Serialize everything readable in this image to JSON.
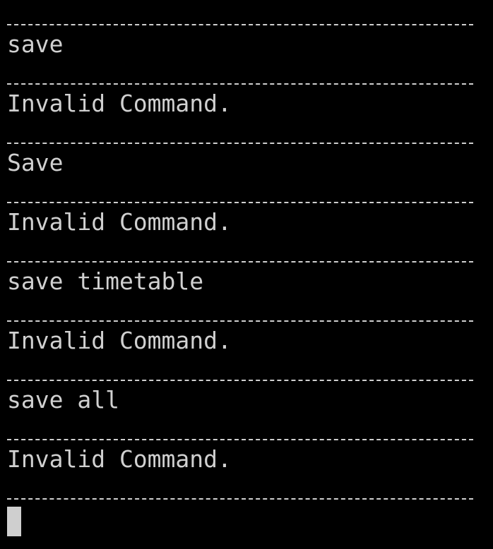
{
  "terminal": {
    "lines": [
      {
        "type": "separator"
      },
      {
        "type": "text",
        "text": "save"
      },
      {
        "type": "separator"
      },
      {
        "type": "text",
        "text": "Invalid Command."
      },
      {
        "type": "separator"
      },
      {
        "type": "text",
        "text": "Save"
      },
      {
        "type": "separator"
      },
      {
        "type": "text",
        "text": "Invalid Command."
      },
      {
        "type": "separator"
      },
      {
        "type": "text",
        "text": "save timetable"
      },
      {
        "type": "separator"
      },
      {
        "type": "text",
        "text": "Invalid Command."
      },
      {
        "type": "separator"
      },
      {
        "type": "text",
        "text": "save all"
      },
      {
        "type": "separator"
      },
      {
        "type": "text",
        "text": "Invalid Command."
      },
      {
        "type": "separator"
      },
      {
        "type": "cursor"
      }
    ]
  },
  "colors": {
    "background": "#000000",
    "foreground": "#d0d0d0",
    "separator": "#cfcfcf",
    "cursor": "#cfcfcf"
  }
}
